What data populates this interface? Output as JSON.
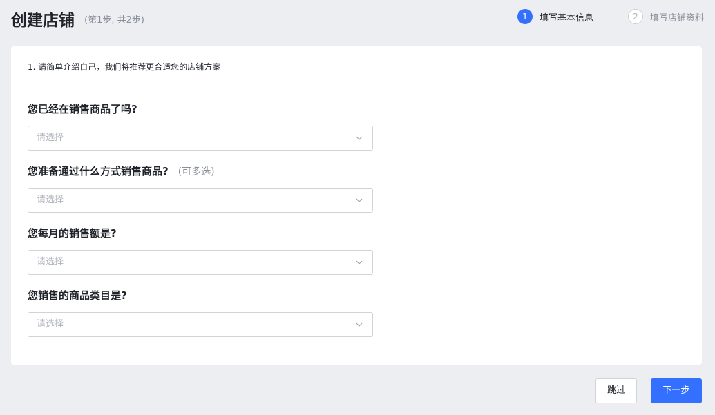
{
  "header": {
    "title": "创建店铺",
    "subtitle": "(第1步, 共2步)"
  },
  "steps": [
    {
      "number": "1",
      "label": "填写基本信息",
      "state": "active"
    },
    {
      "number": "2",
      "label": "填写店铺资料",
      "state": "inactive"
    }
  ],
  "form": {
    "intro": "1. 请简单介绍自己，我们将推荐更合适您的店铺方案",
    "questions": [
      {
        "label": "您已经在销售商品了吗?",
        "note": "",
        "placeholder": "请选择"
      },
      {
        "label": "您准备通过什么方式销售商品?",
        "note": "(可多选)",
        "placeholder": "请选择"
      },
      {
        "label": "您每月的销售额是?",
        "note": "",
        "placeholder": "请选择"
      },
      {
        "label": "您销售的商品类目是?",
        "note": "",
        "placeholder": "请选择"
      }
    ]
  },
  "footer": {
    "skip_label": "跳过",
    "next_label": "下一步"
  },
  "colors": {
    "accent": "#3370ff",
    "background": "#eceef2"
  }
}
